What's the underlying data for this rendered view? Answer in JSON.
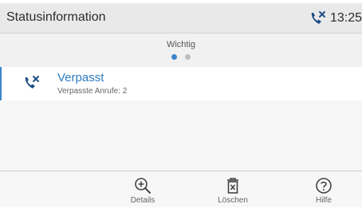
{
  "header": {
    "title": "Statusinformation",
    "time": "13:25",
    "status_icon": "missed-call-icon"
  },
  "section": {
    "label": "Wichtig",
    "pages": 2,
    "current_page": 1
  },
  "items": [
    {
      "title": "Verpasst",
      "subtitle": "Verpasste Anrufe: 2",
      "icon": "missed-call-icon"
    }
  ],
  "toolbar": {
    "details_label": "Details",
    "delete_label": "Löschen",
    "help_label": "Hilfe"
  },
  "colors": {
    "accent": "#3a85c8",
    "icon": "#1f4f86"
  }
}
